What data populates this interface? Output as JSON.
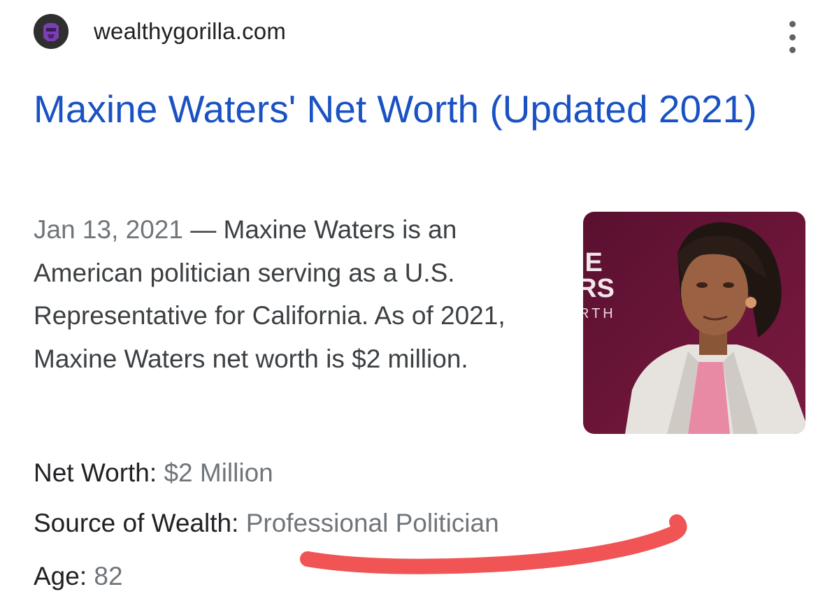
{
  "result": {
    "site_name": "wealthygorilla.com",
    "favicon": "gorilla-logo-icon",
    "menu_icon": "more-vert-icon",
    "title": "Maxine Waters' Net Worth (Updated 2021)",
    "date": "Jan 13, 2021",
    "separator": " — ",
    "snippet": "Maxine Waters is an American politician serving as a U.S. Representative for California. As of 2021, Maxine Waters net worth is $2 million.",
    "thumbnail": {
      "letters": [
        "IE",
        "RS",
        "RTH"
      ]
    },
    "facts": [
      {
        "label": "Net Worth: ",
        "value": "$2 Million"
      },
      {
        "label": "Source of Wealth: ",
        "value": "Professional Politician"
      },
      {
        "label": "Age: ",
        "value": "82"
      }
    ]
  },
  "colors": {
    "title_link": "#1a52c4",
    "body_text": "#3c4043",
    "muted_text": "#70757a",
    "annotation_red": "#f05454",
    "thumb_bg": "#6b1535"
  }
}
